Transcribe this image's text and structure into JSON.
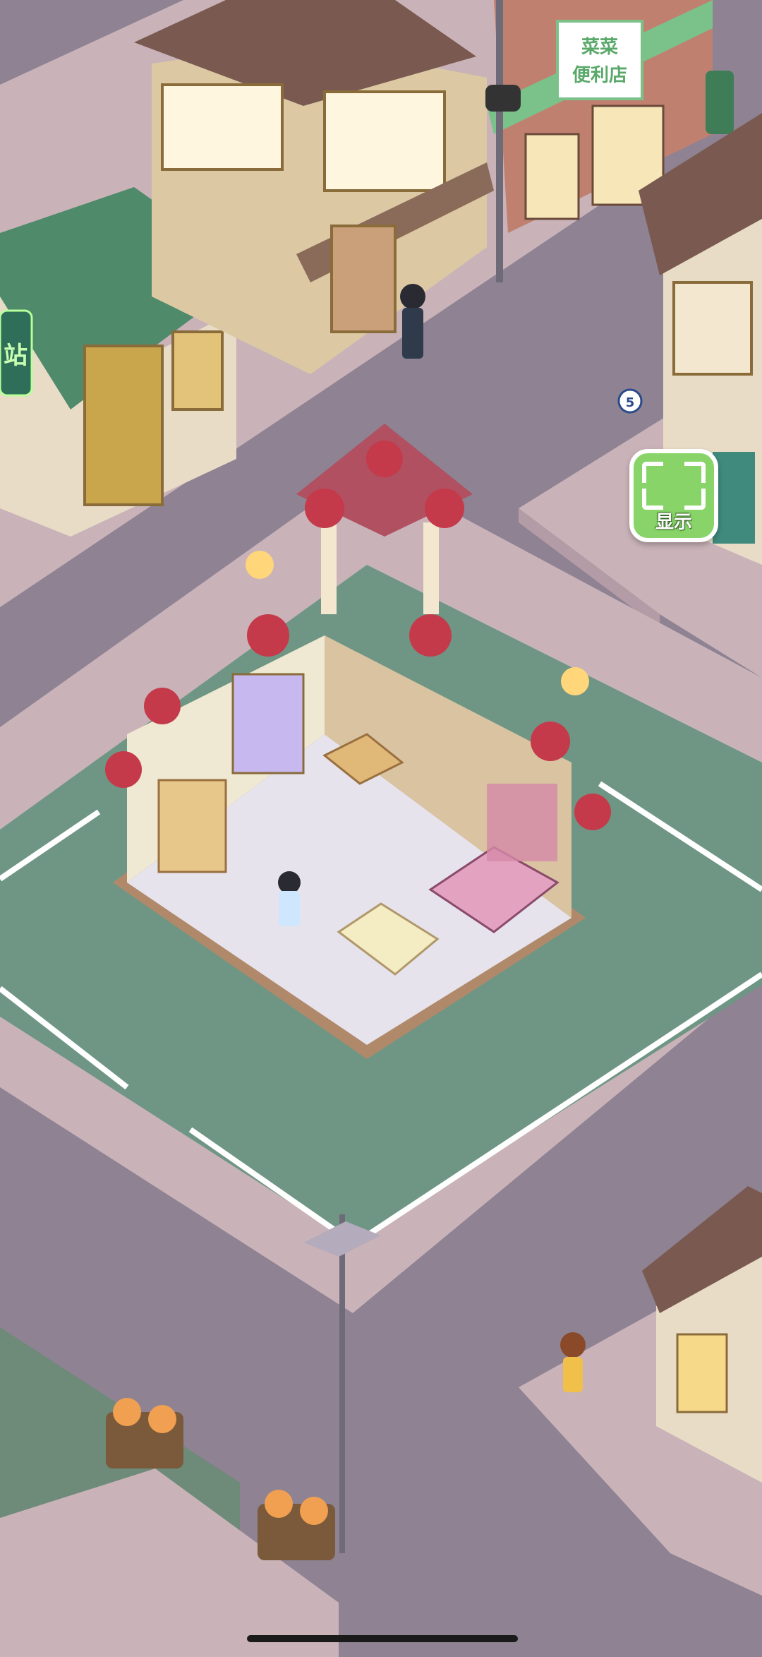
{
  "game": {
    "buttons": {
      "show_label": "显示"
    },
    "shop_sign": {
      "line1": "菜菜",
      "line2": "便利店"
    },
    "neon_sign": {
      "text": "站"
    },
    "road_signs": {
      "number_sign": "5"
    }
  },
  "colors": {
    "road": "#8e8293",
    "sidewalk": "#c9b3b8",
    "lawn": "#6f9685",
    "room_floor": "#e6e3ec",
    "wall_wood": "#b0896a",
    "roof_green": "#4f8a6a",
    "roof_brown": "#7a5a50",
    "button_green": "#88d468"
  },
  "icons": [
    "show-scan-icon",
    "street-lamp-icon",
    "traffic-light-icon",
    "mailbox-icon"
  ]
}
